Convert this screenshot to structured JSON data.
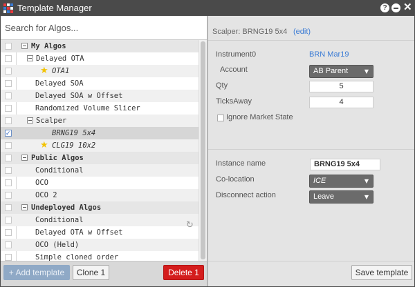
{
  "window": {
    "title": "Template Manager"
  },
  "search": {
    "placeholder": "Search for Algos..."
  },
  "tree": {
    "rows": [
      {
        "label": "My Algos",
        "type": "group"
      },
      {
        "label": "Delayed OTA",
        "type": "subgroup"
      },
      {
        "label": "OTA1",
        "type": "item-star"
      },
      {
        "label": "Delayed SOA",
        "type": "item"
      },
      {
        "label": "Delayed SOA w Offset",
        "type": "item"
      },
      {
        "label": "Randomized Volume Slicer",
        "type": "item"
      },
      {
        "label": "Scalper",
        "type": "subgroup"
      },
      {
        "label": "BRNG19 5x4",
        "type": "item-selected",
        "checked": true
      },
      {
        "label": "CLG19 10x2",
        "type": "item-star"
      },
      {
        "label": "Public Algos",
        "type": "group"
      },
      {
        "label": "Conditional",
        "type": "item"
      },
      {
        "label": "OCO",
        "type": "item"
      },
      {
        "label": "OCO 2",
        "type": "item"
      },
      {
        "label": "Undeployed Algos",
        "type": "group"
      },
      {
        "label": "Conditional",
        "type": "item"
      },
      {
        "label": "Delayed OTA w Offset",
        "type": "item"
      },
      {
        "label": "OCO (Held)",
        "type": "item"
      },
      {
        "label": "Simple cloned order",
        "type": "item"
      }
    ]
  },
  "left_footer": {
    "add_label": "+ Add template",
    "clone_label": "Clone 1",
    "delete_label": "Delete 1"
  },
  "detail": {
    "title": "Scalper: BRNG19 5x4",
    "edit_label": "(edit)",
    "instrument_label": "Instrument0",
    "instrument_value": "BRN Mar19",
    "account_label": "Account",
    "account_value": "AB Parent",
    "qty_label": "Qty",
    "qty_value": "5",
    "ticks_label": "TicksAway",
    "ticks_value": "4",
    "ignore_label": "Ignore Market State",
    "instance_label": "Instance name",
    "instance_value": "BRNG19 5x4",
    "colocation_label": "Co-location",
    "colocation_value": "ICE",
    "disconnect_label": "Disconnect action",
    "disconnect_value": "Leave",
    "save_label": "Save template"
  },
  "colors": {
    "titlebar": "#4a4a4a",
    "link": "#3a7bd5",
    "delete": "#d41d1d",
    "add": "#8fa9c6",
    "star": "#f2c200"
  }
}
